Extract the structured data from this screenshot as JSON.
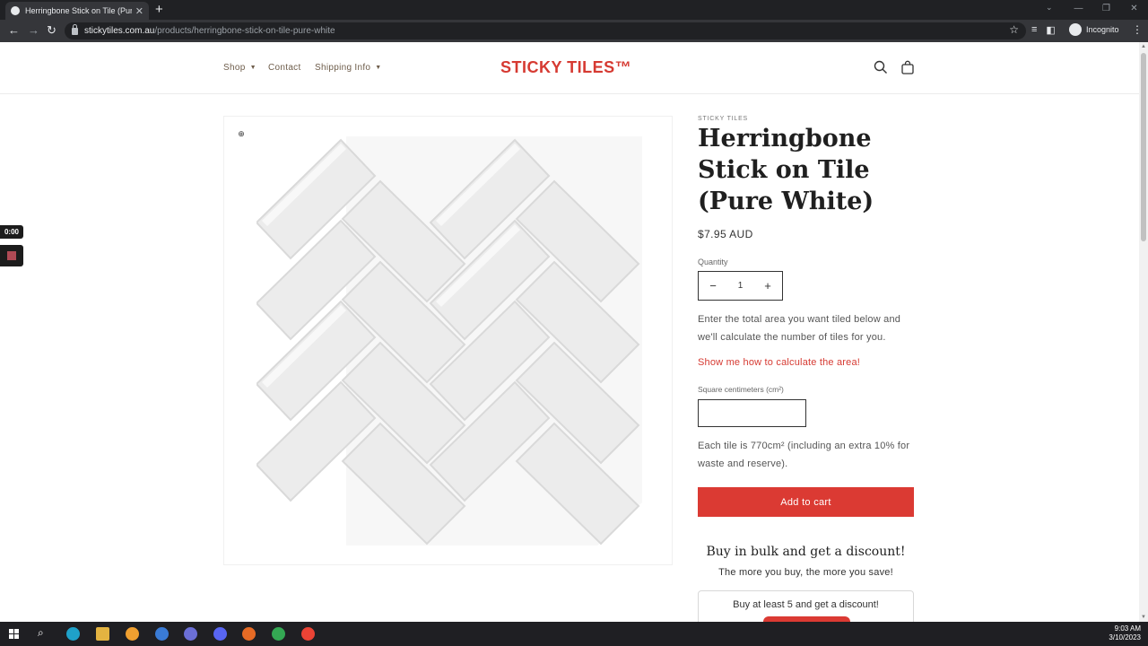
{
  "browser": {
    "tab_title": "Herringbone Stick on Tile (Pure W",
    "tab_close": "✕",
    "new_tab": "+",
    "url_host": "stickytiles.com.au",
    "url_path": "/products/herringbone-stick-on-tile-pure-white",
    "profile_label": "Incognito",
    "back": "←",
    "forward": "→",
    "reload": "↻",
    "star": "☆",
    "menu": "⋮",
    "win_minimize": "—",
    "win_restore": "❐",
    "win_close": "✕",
    "tabs_chevron": "⌄"
  },
  "header": {
    "nav": [
      {
        "label": "Shop"
      },
      {
        "label": "Contact"
      },
      {
        "label": "Shipping Info"
      }
    ],
    "logo": "STICKY TILES™"
  },
  "product": {
    "vendor": "STICKY TILES",
    "title": "Herringbone Stick on Tile (Pure White)",
    "price": "$7.95 AUD",
    "quantity_label": "Quantity",
    "quantity_value": "1",
    "qty_minus": "−",
    "qty_plus": "+",
    "calc_intro": "Enter the total area you want tiled below and we'll calculate the number of tiles for you.",
    "calc_link": "Show me how to calculate the area!",
    "sqcm_label": "Square centimeters (cm²)",
    "sqcm_value": "",
    "tile_note": "Each tile is 770cm² (including an extra 10% for waste and reserve).",
    "add_to_cart": "Add to cart",
    "bulk_title": "Buy in bulk and get a discount!",
    "bulk_sub": "The more you buy, the more you save!",
    "bulk_offer": "Buy at least 5 and get a discount!",
    "zoom": "⊕"
  },
  "recorder": {
    "timer": "0:00"
  },
  "taskbar": {
    "time": "9:03 AM",
    "date": "3/10/2023",
    "search": "⌕"
  },
  "colors": {
    "brand_red": "#d63a32",
    "nav_text": "#6e5d4b",
    "button_red": "#db3a33"
  }
}
